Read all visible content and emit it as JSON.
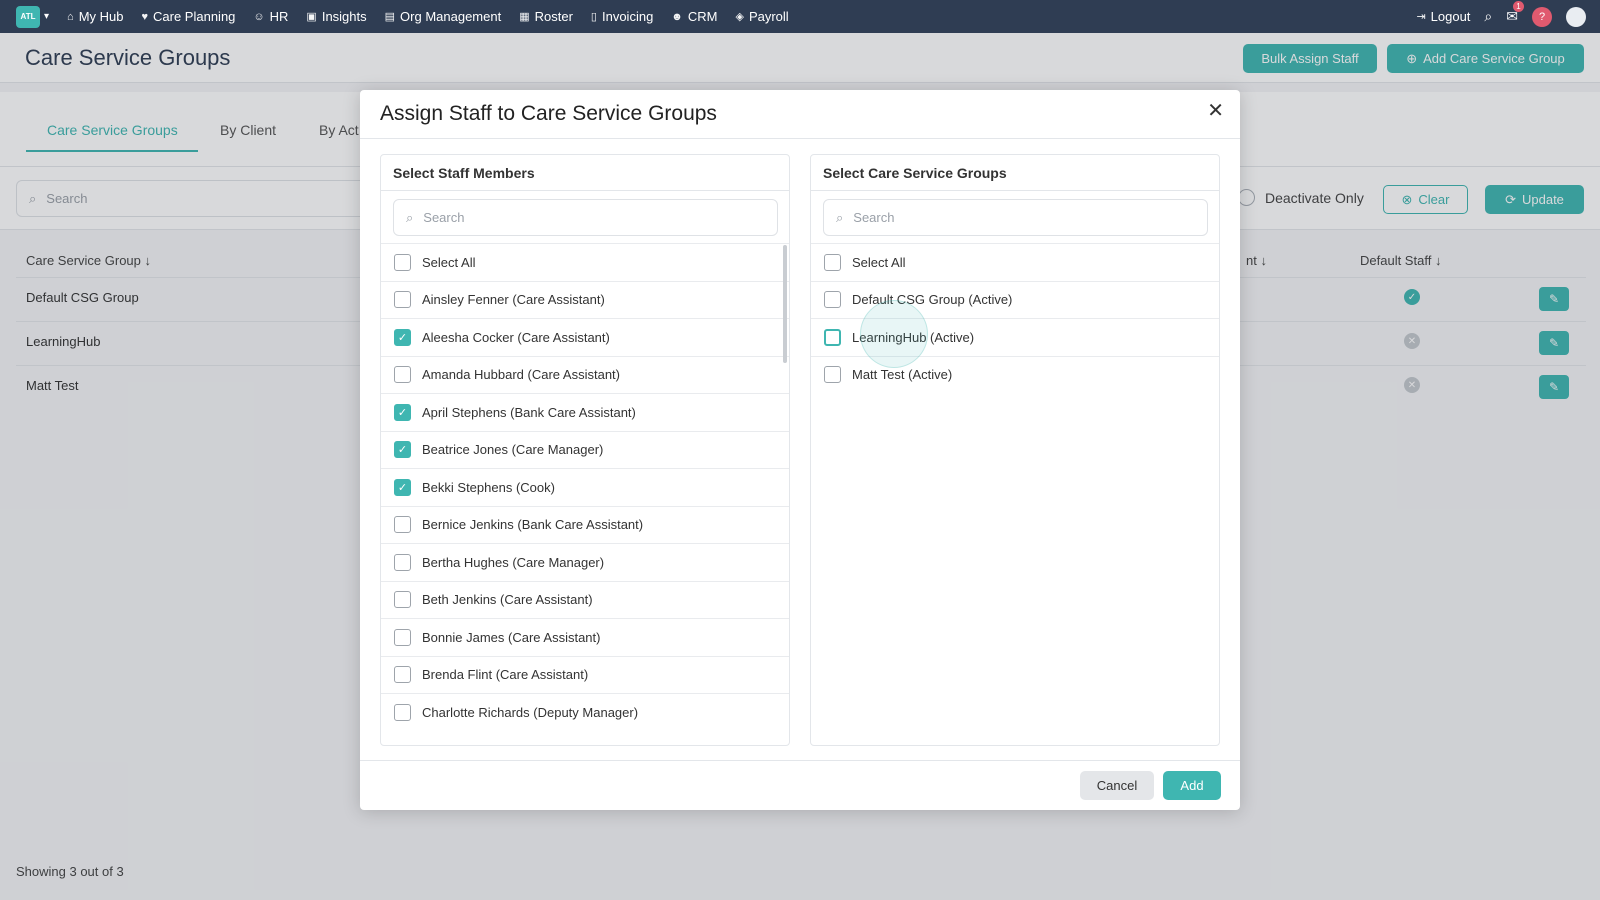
{
  "nav": {
    "logo": "ATL",
    "items": [
      {
        "label": "My Hub",
        "icon": "home-icon"
      },
      {
        "label": "Care Planning",
        "icon": "heart-icon"
      },
      {
        "label": "HR",
        "icon": "people-icon"
      },
      {
        "label": "Insights",
        "icon": "chart-icon"
      },
      {
        "label": "Org Management",
        "icon": "building-icon"
      },
      {
        "label": "Roster",
        "icon": "calendar-icon"
      },
      {
        "label": "Invoicing",
        "icon": "document-icon"
      },
      {
        "label": "CRM",
        "icon": "contacts-icon"
      },
      {
        "label": "Payroll",
        "icon": "payroll-icon"
      }
    ],
    "logout": "Logout",
    "mail_badge": "1",
    "help": "?"
  },
  "page": {
    "title": "Care Service Groups",
    "bulk_assign": "Bulk Assign Staff",
    "add_group": "Add Care Service Group"
  },
  "tabs": [
    "Care Service Groups",
    "By Client",
    "By Act"
  ],
  "filters": {
    "search_placeholder": "Search",
    "deactivate_label": "Deactivate Only",
    "clear": "Clear",
    "update": "Update"
  },
  "table": {
    "col_group": "Care Service Group",
    "col_partial": "nt",
    "col_default": "Default Staff",
    "rows": [
      {
        "name": "Default CSG Group",
        "default": true
      },
      {
        "name": "LearningHub",
        "default": false
      },
      {
        "name": "Matt Test",
        "default": false
      }
    ]
  },
  "showing": "Showing 3 out of 3",
  "modal": {
    "title": "Assign Staff to Care Service Groups",
    "staff_title": "Select Staff Members",
    "groups_title": "Select Care Service Groups",
    "search_placeholder": "Search",
    "select_all": "Select All",
    "staff": [
      {
        "label": "Ainsley Fenner (Care Assistant)",
        "checked": false
      },
      {
        "label": "Aleesha Cocker (Care Assistant)",
        "checked": true
      },
      {
        "label": "Amanda Hubbard (Care Assistant)",
        "checked": false
      },
      {
        "label": "April Stephens (Bank Care Assistant)",
        "checked": true
      },
      {
        "label": "Beatrice Jones (Care Manager)",
        "checked": true
      },
      {
        "label": "Bekki Stephens (Cook)",
        "checked": true
      },
      {
        "label": "Bernice Jenkins (Bank Care Assistant)",
        "checked": false
      },
      {
        "label": "Bertha Hughes (Care Manager)",
        "checked": false
      },
      {
        "label": "Beth Jenkins (Care Assistant)",
        "checked": false
      },
      {
        "label": "Bonnie James (Care Assistant)",
        "checked": false
      },
      {
        "label": "Brenda Flint (Care Assistant)",
        "checked": false
      },
      {
        "label": "Charlotte Richards (Deputy Manager)",
        "checked": false
      }
    ],
    "groups": [
      {
        "label": "Default CSG Group (Active)",
        "checked": false
      },
      {
        "label": "LearningHub (Active)",
        "checked": false
      },
      {
        "label": "Matt Test (Active)",
        "checked": false
      }
    ],
    "cancel": "Cancel",
    "add": "Add"
  },
  "colors": {
    "accent": "#3fb6b1",
    "nav_bg": "#2f3d53",
    "danger": "#e05a6f"
  }
}
